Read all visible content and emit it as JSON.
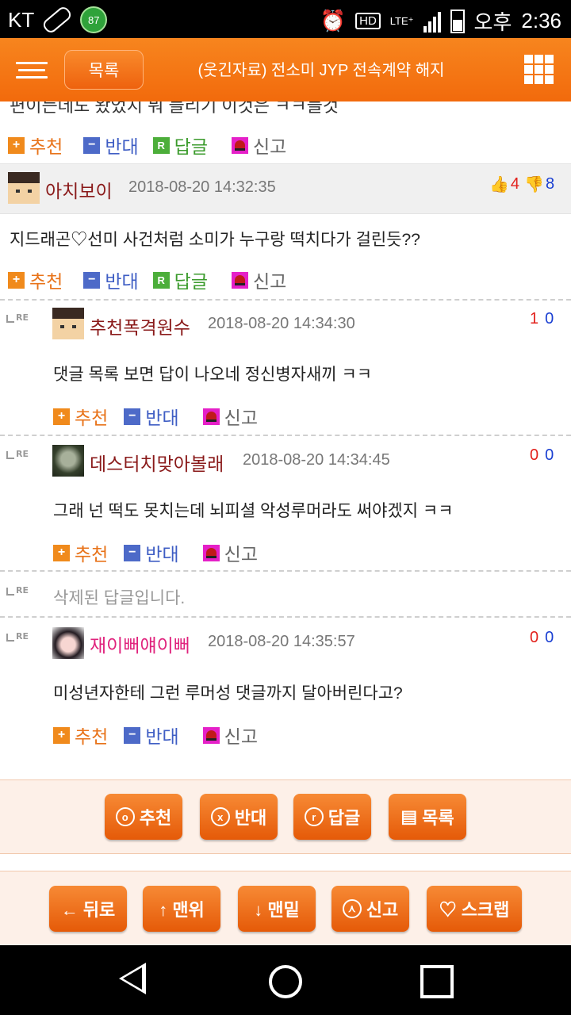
{
  "status_bar": {
    "carrier": "KT",
    "badge": "87",
    "hd": "HD",
    "lte": "LTE⁺",
    "ampm": "오후",
    "time": "2:36"
  },
  "header": {
    "list_button": "목록",
    "title": "(웃긴자료) 전소미 JYP 전속계약 해지"
  },
  "partial_top_text": "편이든데도 왔었지 뭐 들리기 이것은 ㅋㅋ들것",
  "actions": {
    "recommend": "추천",
    "oppose": "반대",
    "reply": "답글",
    "report": "신고"
  },
  "comments": [
    {
      "nickname": "아치보이",
      "date": "2018-08-20 14:32:35",
      "up": "4",
      "down": "8",
      "text": "지드래곤♡선미 사건처럼 소미가 누구랑 떡치다가 걸린듯??"
    }
  ],
  "replies": [
    {
      "re": "RE",
      "nickname": "추천폭격원수",
      "date": "2018-08-20 14:34:30",
      "up": "1",
      "down": "0",
      "text": "댓글 목록 보면 답이 나오네 정신병자새끼 ㅋㅋ"
    },
    {
      "re": "RE",
      "nickname": "데스터치맞아볼래",
      "date": "2018-08-20 14:34:45",
      "up": "0",
      "down": "0",
      "text": "그래 넌 떡도 못치는데 뇌피셜 악성루머라도 써야겠지 ㅋㅋ"
    },
    {
      "re": "RE",
      "deleted_text": "삭제된 답글입니다."
    },
    {
      "re": "RE",
      "nickname": "재이뻐얘이뻐",
      "date": "2018-08-20 14:35:57",
      "up": "0",
      "down": "0",
      "text": "미성년자한테 그런 루머성 댓글까지 달아버린다고?"
    }
  ],
  "vote_buttons": {
    "recommend": "추천",
    "oppose": "반대",
    "reply": "답글",
    "list": "목록"
  },
  "nav_buttons": {
    "back": "← 뒤로",
    "top": "↑ 맨위",
    "bottom": "↓ 맨밑",
    "report": "신고",
    "scrap": "♡ 스크랩"
  },
  "colors": {
    "accent": "#f26a0c",
    "nick": "#8a1a1a",
    "nick_pink": "#e0237d",
    "up": "#e2211c",
    "down": "#1a3fd2"
  }
}
